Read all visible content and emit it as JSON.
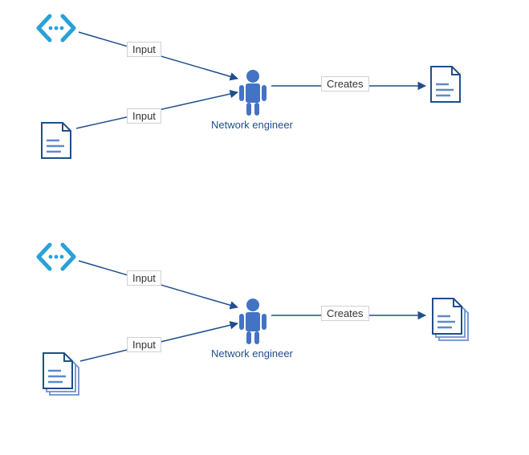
{
  "diagram": {
    "top": {
      "input1": "Input",
      "input2": "Input",
      "creates": "Creates",
      "role": "Network engineer"
    },
    "bottom": {
      "input1": "Input",
      "input2": "Input",
      "creates": "Creates",
      "role": "Network engineer"
    }
  }
}
